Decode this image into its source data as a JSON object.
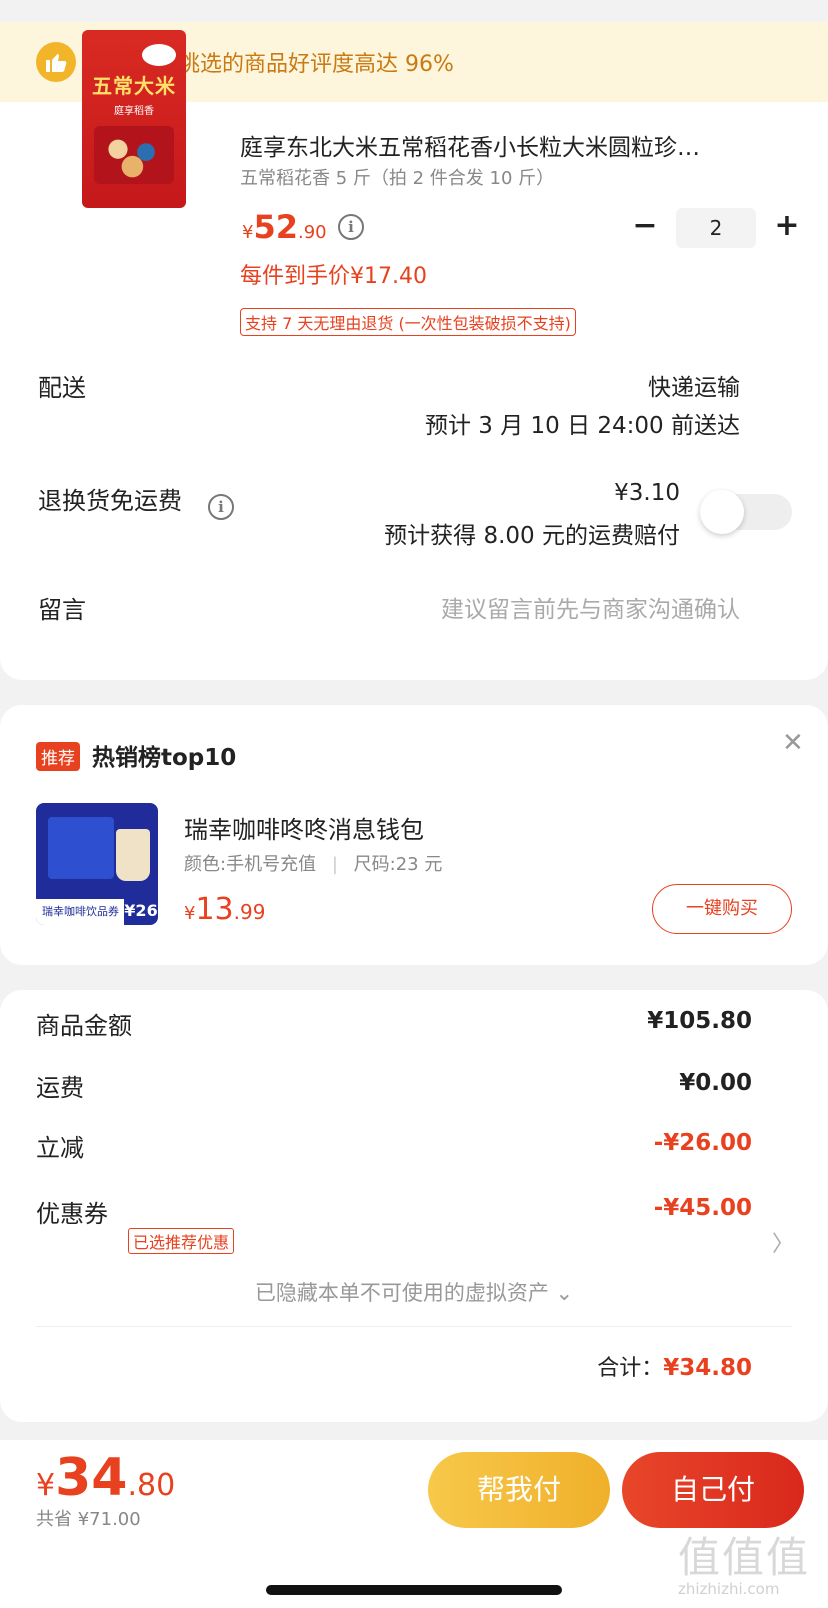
{
  "banner": {
    "text": "恭喜你，挑选的商品好评度高达 96%"
  },
  "product": {
    "title": "庭享东北大米五常稻花香小长粒大米圆粒珍…",
    "spec": "五常稻花香 5 斤（拍 2 件合发 10 斤）",
    "price_symbol": "¥",
    "price_int": "52",
    "price_dec": ".90",
    "unit_price": "每件到手价¥17.40",
    "return_tag": "支持 7 天无理由退货 (一次性包装破损不支持)",
    "quantity": "2",
    "image_text": "五常大米",
    "image_subtext": "庭享稻香"
  },
  "delivery": {
    "label": "配送",
    "method": "快递运输",
    "eta": "预计 3 月 10 日 24:00 前送达"
  },
  "return_insurance": {
    "label": "退换货免运费",
    "price": "¥3.10",
    "note": "预计获得 8.00 元的运费赔付",
    "enabled": false
  },
  "message": {
    "label": "留言",
    "placeholder": "建议留言前先与商家沟通确认"
  },
  "recommend": {
    "badge": "推荐",
    "title": "热销榜top10",
    "item_name": "瑞幸咖啡咚咚消息钱包",
    "item_spec_color": "颜色:手机号充值",
    "item_spec_size": "尺码:23 元",
    "price_symbol": "¥",
    "price_int": "13",
    "price_dec": ".99",
    "buy_label": "一键购买",
    "image_bar_text": "瑞幸咖啡饮品券",
    "image_corner_text": "¥26"
  },
  "summary": {
    "goods_label": "商品金额",
    "goods_value": "¥105.80",
    "shipping_label": "运费",
    "shipping_value": "¥0.00",
    "discount_label": "立减",
    "discount_value": "-¥26.00",
    "coupon_label": "优惠券",
    "coupon_tag": "已选推荐优惠",
    "coupon_value": "-¥45.00",
    "hidden_note": "已隐藏本单不可使用的虚拟资产 ⌄",
    "total_label": "合计：",
    "total_value": "¥34.80"
  },
  "bottom": {
    "price_symbol": "¥",
    "price_int": "34",
    "price_dec": ".80",
    "saved": "共省 ¥71.00",
    "help_pay": "帮我付",
    "self_pay": "自己付"
  },
  "watermark": {
    "big": "值值值",
    "small": "zhizhizhi.com"
  },
  "colors": {
    "accent": "#e8411f",
    "banner_bg": "#fdf5dc",
    "help_btn": "#f0b02a"
  }
}
